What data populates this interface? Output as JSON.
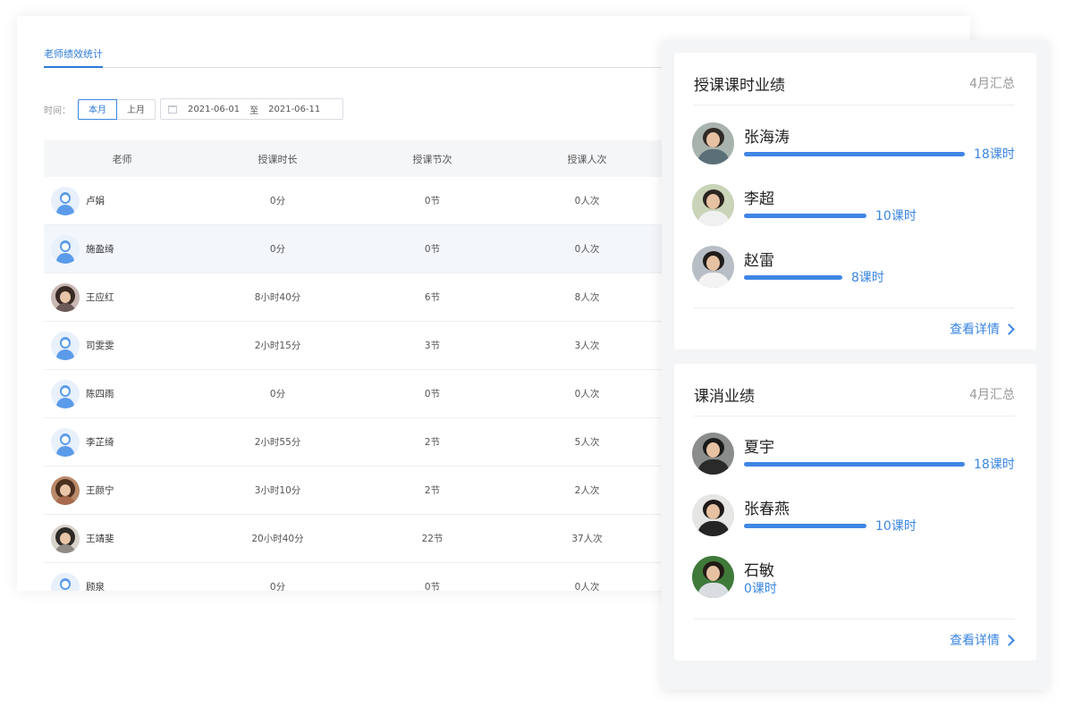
{
  "tabs": {
    "active_label": "老师绩效统计"
  },
  "filter": {
    "time_label": "时间：",
    "this_month_label": "本月",
    "last_month_label": "上月",
    "start_date": "2021-06-01",
    "range_separator": "至",
    "end_date": "2021-06-11"
  },
  "table": {
    "columns": [
      "老师",
      "授课时长",
      "授课节次",
      "授课人次"
    ],
    "rows": [
      {
        "teacher": "卢娟",
        "duration": "0分",
        "sessions": "0节",
        "attendance": "0人次",
        "avatar": "default-avatar"
      },
      {
        "teacher": "施盈绮",
        "duration": "0分",
        "sessions": "0节",
        "attendance": "0人次",
        "avatar": "default-avatar"
      },
      {
        "teacher": "王应红",
        "duration": "8小时40分",
        "sessions": "6节",
        "attendance": "8人次",
        "avatar": "photo-avatar"
      },
      {
        "teacher": "司雯雯",
        "duration": "2小时15分",
        "sessions": "3节",
        "attendance": "3人次",
        "avatar": "default-avatar"
      },
      {
        "teacher": "陈四雨",
        "duration": "0分",
        "sessions": "0节",
        "attendance": "0人次",
        "avatar": "default-avatar"
      },
      {
        "teacher": "李芷绮",
        "duration": "2小时55分",
        "sessions": "2节",
        "attendance": "5人次",
        "avatar": "default-avatar"
      },
      {
        "teacher": "王颜宁",
        "duration": "3小时10分",
        "sessions": "2节",
        "attendance": "2人次",
        "avatar": "photo-avatar"
      },
      {
        "teacher": "王靖斐",
        "duration": "20小时40分",
        "sessions": "22节",
        "attendance": "37人次",
        "avatar": "photo-avatar"
      },
      {
        "teacher": "顾泉",
        "duration": "0分",
        "sessions": "0节",
        "attendance": "0人次",
        "avatar": "default-avatar"
      }
    ]
  },
  "teaching_card": {
    "title": "授课课时业绩",
    "period": "4月汇总",
    "entries": [
      {
        "name": "张海涛",
        "value_label": "18课时",
        "value": 18
      },
      {
        "name": "李超",
        "value_label": "10课时",
        "value": 10
      },
      {
        "name": "赵雷",
        "value_label": "8课时",
        "value": 8
      }
    ],
    "detail_label": "查看详情"
  },
  "consumption_card": {
    "title": "课消业绩",
    "period": "4月汇总",
    "entries": [
      {
        "name": "夏宇",
        "value_label": "18课时",
        "value": 18
      },
      {
        "name": "张春燕",
        "value_label": "10课时",
        "value": 10
      },
      {
        "name": "石敏",
        "value_label": "0课时",
        "value": 0
      }
    ],
    "detail_label": "查看详情"
  },
  "colors": {
    "accent": "#2d7bd8",
    "bar": "#3f86e4",
    "header_bg": "#f5f6f8",
    "highlight_row": "#f3f6fb"
  }
}
